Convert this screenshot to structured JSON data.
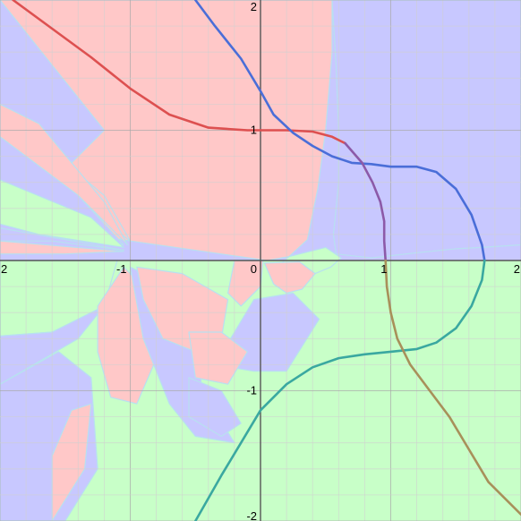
{
  "chart_data": {
    "type": "line",
    "title": "",
    "xlabel": "",
    "ylabel": "",
    "xlim": [
      -2,
      2
    ],
    "ylim": [
      -2,
      2
    ],
    "grid": true,
    "minor_grid_step": 0.2,
    "major_grid_step": 1,
    "x_ticks": [
      {
        "value": -2,
        "label": "2"
      },
      {
        "value": -1,
        "label": "-1"
      },
      {
        "value": 0,
        "label": "0"
      },
      {
        "value": 1,
        "label": "1"
      },
      {
        "value": 2,
        "label": "2"
      }
    ],
    "y_ticks": [
      {
        "value": 2,
        "label": "2"
      },
      {
        "value": 1,
        "label": "1"
      },
      {
        "value": -1,
        "label": "-1"
      },
      {
        "value": -2,
        "label": "-2"
      }
    ],
    "colors": {
      "background": "#ffffff",
      "region_red": "#ffc8c8",
      "region_blue": "#c8c8ff",
      "region_green": "#c8ffc8",
      "region_edge": "#b8e0f0",
      "grid_minor": "#d0d0d0",
      "grid_major": "#a8a8a8",
      "axis": "#555555",
      "curve_red": "#dd5050",
      "curve_blue": "#4a6ed8",
      "curve_purple": "#8c5aa8",
      "curve_teal": "#3aa8a0",
      "curve_olive": "#a8905a"
    },
    "regions": [
      {
        "color": "region_blue",
        "points": [
          [
            0.55,
            2
          ],
          [
            2,
            2
          ],
          [
            2,
            0.12
          ],
          [
            1.7,
            0.1
          ],
          [
            1.5,
            0.09
          ],
          [
            1.2,
            0.06
          ],
          [
            0.85,
            0.02
          ],
          [
            0.58,
            0.05
          ],
          [
            0.56,
            0.2
          ],
          [
            0.6,
            0.6
          ],
          [
            0.6,
            1.0
          ],
          [
            0.58,
            1.5
          ]
        ]
      },
      {
        "color": "region_red",
        "points": [
          [
            -2,
            2
          ],
          [
            0.55,
            2
          ],
          [
            0.55,
            1.6
          ],
          [
            0.5,
            1.0
          ],
          [
            0.44,
            0.55
          ],
          [
            0.36,
            0.16
          ],
          [
            0.22,
            0.03
          ],
          [
            0.05,
            0
          ],
          [
            -1,
            0.15
          ],
          [
            -2,
            0.3
          ],
          [
            -2,
            1.2
          ],
          [
            -1.8,
            1.0
          ],
          [
            -1.2,
            0.5
          ],
          [
            -1.0,
            0.15
          ],
          [
            -1.6,
            0.6
          ],
          [
            -1.2,
            1.0
          ]
        ]
      },
      {
        "color": "region_red",
        "points": [
          [
            -2,
            1.2
          ],
          [
            -1.7,
            1.05
          ],
          [
            -1.2,
            0.45
          ],
          [
            -1.02,
            0.12
          ],
          [
            -1.4,
            0.5
          ],
          [
            -2,
            0.95
          ]
        ]
      },
      {
        "color": "region_blue",
        "points": [
          [
            -2,
            0.95
          ],
          [
            -1.4,
            0.5
          ],
          [
            -1.05,
            0.12
          ],
          [
            -1.5,
            0.25
          ],
          [
            -2,
            0.4
          ]
        ]
      },
      {
        "color": "region_green",
        "points": [
          [
            -2,
            0.62
          ],
          [
            -1.3,
            0.33
          ],
          [
            -1.05,
            0.1
          ],
          [
            -1.7,
            0.2
          ],
          [
            -2,
            0.28
          ]
        ]
      },
      {
        "color": "region_blue",
        "points": [
          [
            -2,
            0.25
          ],
          [
            -1.05,
            0.08
          ],
          [
            -1.6,
            0.15
          ],
          [
            -2,
            0.15
          ]
        ]
      },
      {
        "color": "region_red",
        "points": [
          [
            -2,
            0.15
          ],
          [
            -1.05,
            0.07
          ],
          [
            -1.5,
            0.05
          ],
          [
            -2,
            0.05
          ]
        ]
      },
      {
        "color": "region_green",
        "points": [
          [
            0.22,
            0.03
          ],
          [
            0.5,
            0.1
          ],
          [
            0.62,
            0.02
          ],
          [
            0.54,
            -0.05
          ],
          [
            0.3,
            -0.15
          ],
          [
            0.12,
            -0.2
          ],
          [
            0.07,
            -0.1
          ]
        ]
      },
      {
        "color": "region_red",
        "points": [
          [
            0.03,
            -0.02
          ],
          [
            0.3,
            -0.01
          ],
          [
            0.42,
            -0.1
          ],
          [
            0.32,
            -0.22
          ],
          [
            0.2,
            -0.25
          ],
          [
            0.1,
            -0.18
          ]
        ]
      },
      {
        "color": "region_green",
        "points": [
          [
            -2,
            0
          ],
          [
            -1.1,
            0
          ],
          [
            -1.2,
            -0.35
          ],
          [
            -1.6,
            -0.55
          ],
          [
            -2,
            -0.58
          ]
        ]
      },
      {
        "color": "region_blue",
        "points": [
          [
            -2,
            -0.58
          ],
          [
            -1.6,
            -0.55
          ],
          [
            -1.2,
            -0.35
          ],
          [
            -1.4,
            -0.6
          ],
          [
            -2,
            -0.95
          ]
        ]
      },
      {
        "color": "region_red",
        "points": [
          [
            -1.9,
            -0.95
          ],
          [
            -1.6,
            -0.8
          ],
          [
            -1.5,
            -1.2
          ],
          [
            -1.7,
            -1.8
          ],
          [
            -1.95,
            -1.85
          ],
          [
            -2,
            -1.3
          ]
        ]
      },
      {
        "color": "region_blue",
        "points": [
          [
            -2,
            -0.95
          ],
          [
            -1.55,
            -0.7
          ],
          [
            -1.3,
            -0.9
          ],
          [
            -1.25,
            -1.6
          ],
          [
            -1.5,
            -2
          ],
          [
            -2,
            -2
          ]
        ]
      },
      {
        "color": "region_red",
        "points": [
          [
            -1.6,
            -2
          ],
          [
            -1.35,
            -1.6
          ],
          [
            -1.3,
            -1.1
          ],
          [
            -1.45,
            -1.15
          ],
          [
            -1.6,
            -1.5
          ]
        ]
      },
      {
        "color": "region_red",
        "points": [
          [
            -1.25,
            -0.35
          ],
          [
            -1.05,
            -0.05
          ],
          [
            -0.85,
            -0.25
          ],
          [
            -0.82,
            -0.8
          ],
          [
            -0.95,
            -1.1
          ],
          [
            -1.15,
            -1.05
          ],
          [
            -1.25,
            -0.7
          ]
        ]
      },
      {
        "color": "region_blue",
        "points": [
          [
            -1.0,
            -0.05
          ],
          [
            -0.9,
            -0.6
          ],
          [
            -0.7,
            -1.1
          ],
          [
            -0.5,
            -1.35
          ],
          [
            -0.2,
            -1.4
          ],
          [
            -0.45,
            -1.0
          ],
          [
            -0.5,
            -0.4
          ],
          [
            -0.7,
            -0.2
          ]
        ]
      },
      {
        "color": "region_red",
        "points": [
          [
            -0.95,
            -0.05
          ],
          [
            -0.6,
            -0.1
          ],
          [
            -0.25,
            -0.3
          ],
          [
            -0.3,
            -0.6
          ],
          [
            -0.5,
            -0.7
          ],
          [
            -0.75,
            -0.6
          ],
          [
            -0.9,
            -0.3
          ]
        ]
      },
      {
        "color": "region_red",
        "points": [
          [
            -0.2,
            0
          ],
          [
            0.02,
            0
          ],
          [
            0,
            -0.2
          ],
          [
            -0.15,
            -0.35
          ],
          [
            -0.25,
            -0.25
          ]
        ]
      },
      {
        "color": "region_blue",
        "points": [
          [
            -0.05,
            -0.3
          ],
          [
            0.25,
            -0.25
          ],
          [
            0.45,
            -0.45
          ],
          [
            0.2,
            -0.85
          ],
          [
            -0.05,
            -0.85
          ],
          [
            -0.35,
            -0.8
          ],
          [
            -0.2,
            -0.55
          ]
        ]
      },
      {
        "color": "region_red",
        "points": [
          [
            -0.55,
            -0.55
          ],
          [
            -0.3,
            -0.55
          ],
          [
            -0.1,
            -0.7
          ],
          [
            -0.25,
            -0.95
          ],
          [
            -0.5,
            -0.9
          ]
        ]
      },
      {
        "color": "region_blue",
        "points": [
          [
            -0.55,
            -0.9
          ],
          [
            -0.3,
            -1.0
          ],
          [
            -0.15,
            -1.25
          ],
          [
            -0.3,
            -1.35
          ],
          [
            -0.55,
            -1.2
          ]
        ]
      }
    ],
    "series": [
      {
        "points": [
          [
            -1.9,
            2
          ],
          [
            -1.6,
            1.78
          ],
          [
            -1.3,
            1.56
          ],
          [
            -1.0,
            1.32
          ],
          [
            -0.7,
            1.12
          ],
          [
            -0.4,
            1.02
          ],
          [
            -0.1,
            1.0
          ],
          [
            0.2,
            1.0
          ],
          [
            0.4,
            0.99
          ],
          [
            0.55,
            0.95
          ],
          [
            0.65,
            0.9
          ]
        ],
        "color": "curve_red"
      },
      {
        "points": [
          [
            -0.5,
            2
          ],
          [
            -0.35,
            1.8
          ],
          [
            -0.15,
            1.55
          ],
          [
            0,
            1.3
          ],
          [
            0.1,
            1.12
          ],
          [
            0.25,
            0.98
          ],
          [
            0.4,
            0.88
          ],
          [
            0.55,
            0.8
          ],
          [
            0.7,
            0.75
          ],
          [
            0.85,
            0.74
          ],
          [
            1.0,
            0.72
          ],
          [
            1.2,
            0.72
          ],
          [
            1.35,
            0.68
          ],
          [
            1.5,
            0.55
          ],
          [
            1.62,
            0.35
          ],
          [
            1.7,
            0.12
          ],
          [
            1.72,
            0
          ]
        ],
        "color": "curve_blue"
      },
      {
        "points": [
          [
            0.65,
            0.9
          ],
          [
            0.78,
            0.75
          ],
          [
            0.86,
            0.6
          ],
          [
            0.92,
            0.45
          ],
          [
            0.95,
            0.3
          ],
          [
            0.95,
            0.15
          ],
          [
            0.96,
            0
          ]
        ],
        "color": "curve_purple"
      },
      {
        "points": [
          [
            1.72,
            0
          ],
          [
            1.7,
            -0.15
          ],
          [
            1.62,
            -0.35
          ],
          [
            1.5,
            -0.52
          ],
          [
            1.35,
            -0.63
          ],
          [
            1.2,
            -0.68
          ],
          [
            1.0,
            -0.7
          ],
          [
            0.8,
            -0.72
          ],
          [
            0.6,
            -0.75
          ],
          [
            0.4,
            -0.82
          ],
          [
            0.2,
            -0.95
          ],
          [
            0,
            -1.15
          ],
          [
            -0.15,
            -1.4
          ],
          [
            -0.3,
            -1.65
          ],
          [
            -0.5,
            -2
          ]
        ],
        "color": "curve_teal"
      },
      {
        "points": [
          [
            0.96,
            0
          ],
          [
            0.97,
            -0.2
          ],
          [
            1.0,
            -0.4
          ],
          [
            1.05,
            -0.6
          ],
          [
            1.15,
            -0.8
          ],
          [
            1.3,
            -1.0
          ],
          [
            1.45,
            -1.2
          ],
          [
            1.6,
            -1.45
          ],
          [
            1.75,
            -1.7
          ],
          [
            2,
            -1.95
          ]
        ],
        "color": "curve_olive"
      }
    ]
  }
}
